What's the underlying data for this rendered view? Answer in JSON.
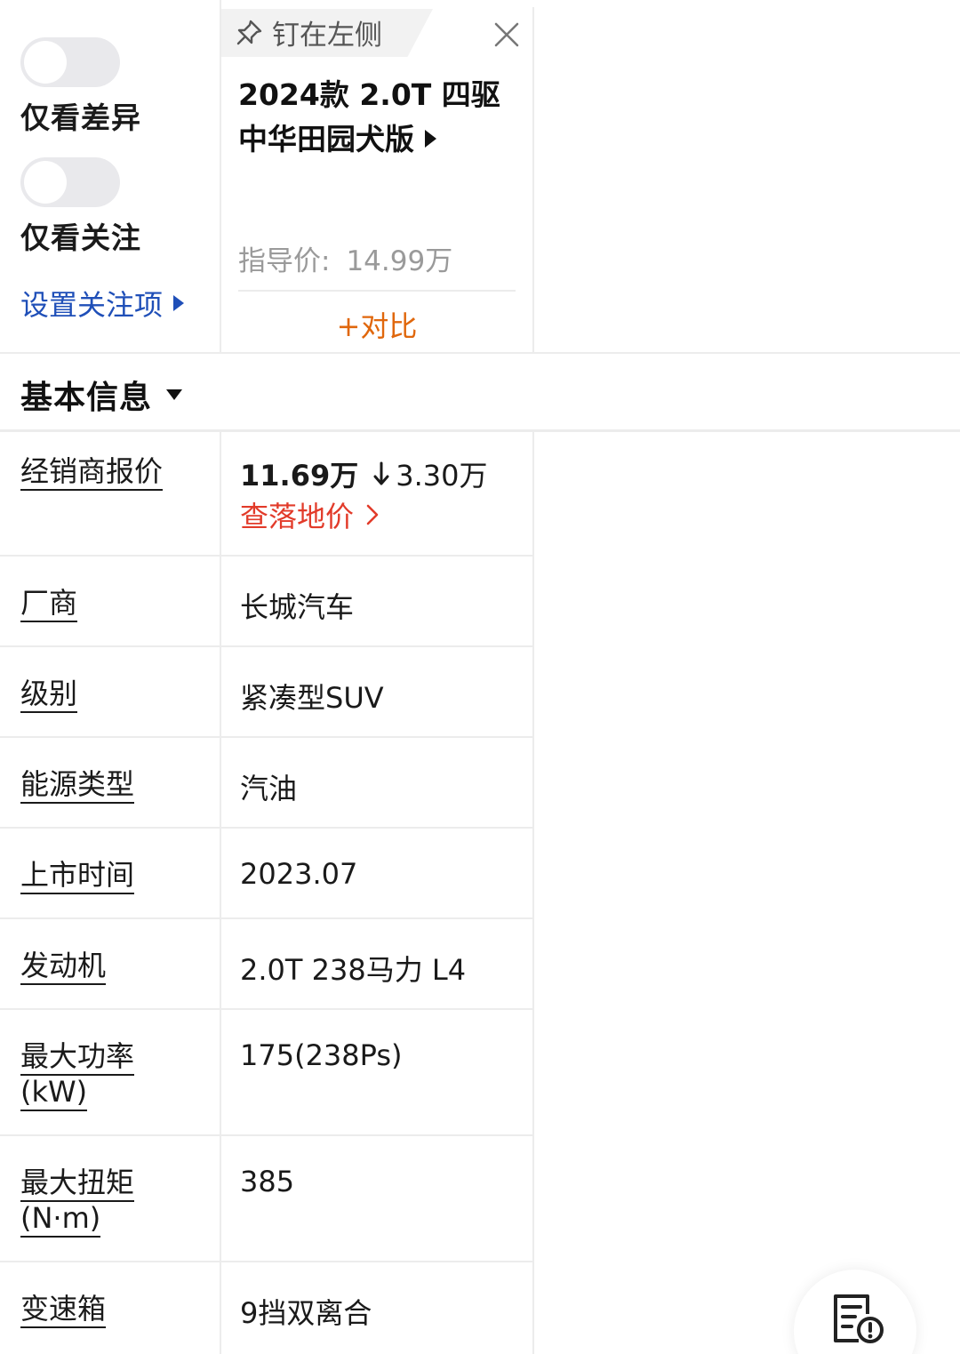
{
  "toggles": [
    {
      "label": "仅看差异",
      "on": false
    },
    {
      "label": "仅看关注",
      "on": false
    }
  ],
  "focus_link": "设置关注项",
  "car": {
    "pin_label": "钉在左侧",
    "name": "2024款 2.0T 四驱 中华田园犬版",
    "guide_price_label": "指导价:",
    "guide_price_value": "14.99万",
    "compare_label": "+对比"
  },
  "section": {
    "title": "基本信息"
  },
  "dealer": {
    "label": "经销商报价",
    "price": "11.69万",
    "drop": "3.30万",
    "link": "查落地价"
  },
  "params": [
    {
      "label": "厂商",
      "value": "长城汽车"
    },
    {
      "label": "级别",
      "value": "紧凑型SUV"
    },
    {
      "label": "能源类型",
      "value": "汽油"
    },
    {
      "label": "上市时间",
      "value": "2023.07"
    },
    {
      "label": "发动机",
      "value": "2.0T 238马力 L4"
    },
    {
      "label": "最大功率",
      "label2": "(kW)",
      "value": "175(238Ps)"
    },
    {
      "label": "最大扭矩",
      "label2": "(N·m)",
      "value": "385"
    },
    {
      "label": "变速箱",
      "value": "9挡双离合"
    }
  ],
  "colors": {
    "link_blue": "#1f4fb8",
    "accent_orange": "#e0670c",
    "alert_red": "#e23b2a"
  },
  "icons": {
    "pin": "pin-icon",
    "close": "close-icon",
    "fab": "feedback-icon"
  }
}
